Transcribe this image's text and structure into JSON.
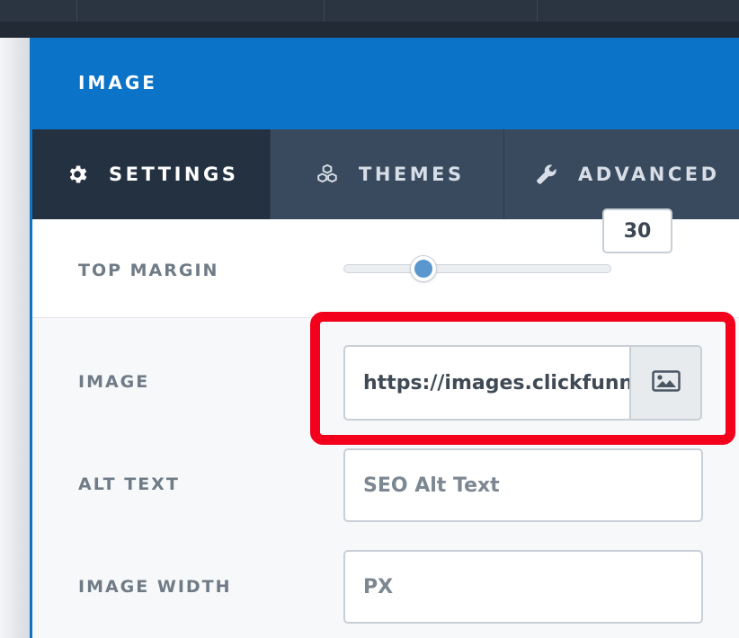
{
  "panel": {
    "title": "IMAGE"
  },
  "tabs": [
    {
      "label": "SETTINGS",
      "icon": "gear-icon",
      "active": true
    },
    {
      "label": "THEMES",
      "icon": "cubes-icon",
      "active": false
    },
    {
      "label": "ADVANCED",
      "icon": "wrench-icon",
      "active": false
    }
  ],
  "settings": {
    "top_margin": {
      "label": "TOP MARGIN",
      "value": "30",
      "slider_fraction": 0.3
    },
    "image": {
      "label": "IMAGE",
      "value": "https://images.clickfunnels",
      "button_icon": "image-icon"
    },
    "alt_text": {
      "label": "ALT TEXT",
      "placeholder": "SEO Alt Text"
    },
    "image_width": {
      "label": "IMAGE WIDTH",
      "placeholder": "PX"
    }
  },
  "colors": {
    "header": "#0b73c8",
    "tab_bar": "#3a4a5e",
    "tab_active": "#243140",
    "highlight": "#f2001c",
    "slider_thumb": "#5b97cf"
  }
}
